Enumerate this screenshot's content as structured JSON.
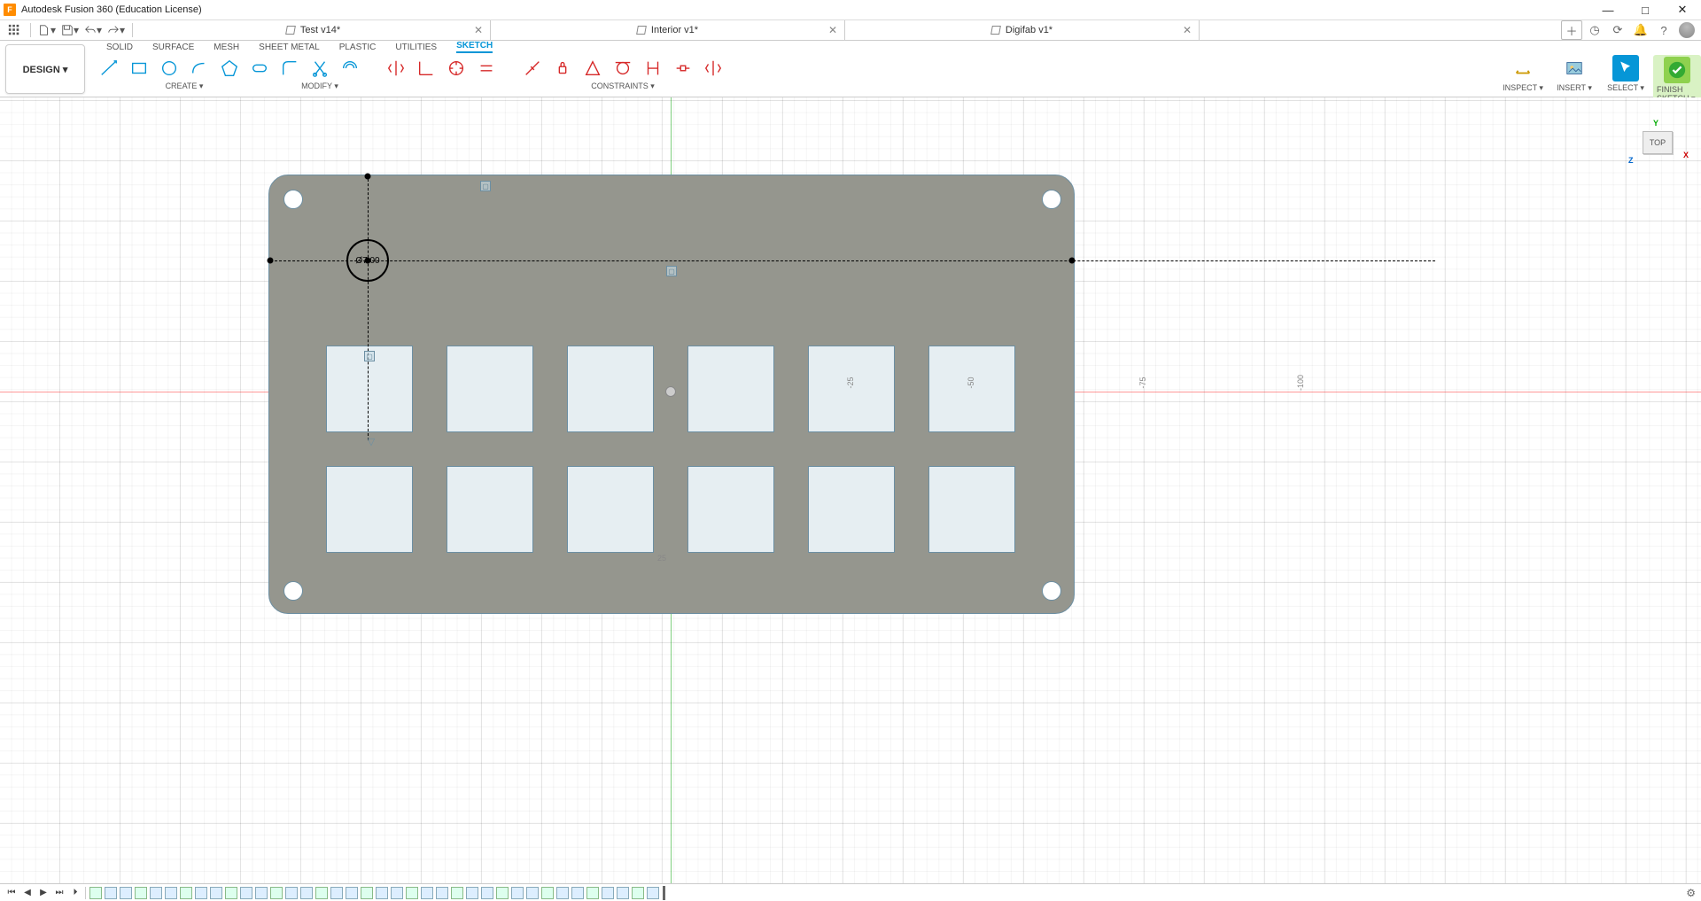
{
  "app": {
    "title": "Autodesk Fusion 360 (Education License)",
    "icon_letter": "F"
  },
  "window_controls": {
    "min": "—",
    "max": "□",
    "close": "✕"
  },
  "qat_icons": [
    "grid-apps-icon",
    "file-icon",
    "save-icon",
    "undo-icon",
    "redo-icon"
  ],
  "doc_tabs": [
    {
      "label": "Test v14*",
      "closable": true
    },
    {
      "label": "Interior v1*",
      "closable": true
    },
    {
      "label": "Digifab v1*",
      "closable": true
    }
  ],
  "header_right_icons": [
    "new-tab",
    "extensions",
    "updates",
    "notifications",
    "help",
    "profile"
  ],
  "design_button": "DESIGN ▾",
  "env_tabs": [
    "SOLID",
    "SURFACE",
    "MESH",
    "SHEET METAL",
    "PLASTIC",
    "UTILITIES",
    "SKETCH"
  ],
  "active_env_tab": "SKETCH",
  "ribbon_groups": {
    "create": "CREATE ▾",
    "modify": "MODIFY ▾",
    "constraints": "CONSTRAINTS ▾",
    "inspect": "INSPECT ▾",
    "insert": "INSERT ▾",
    "select": "SELECT ▾",
    "finish": "FINISH SKETCH ▾"
  },
  "viewcube": {
    "face": "TOP",
    "y": "Y",
    "x": "X",
    "z": "Z"
  },
  "sketch": {
    "dimension_label": "Ø7.00",
    "grid_labels": {
      "a": "-25",
      "b": "-50",
      "c": "-75",
      "d": "-100",
      "e": "25"
    }
  },
  "timeline": {
    "controls": [
      "⏮",
      "◀",
      "▶",
      "⏭",
      "⏵"
    ],
    "features_count": 38
  }
}
